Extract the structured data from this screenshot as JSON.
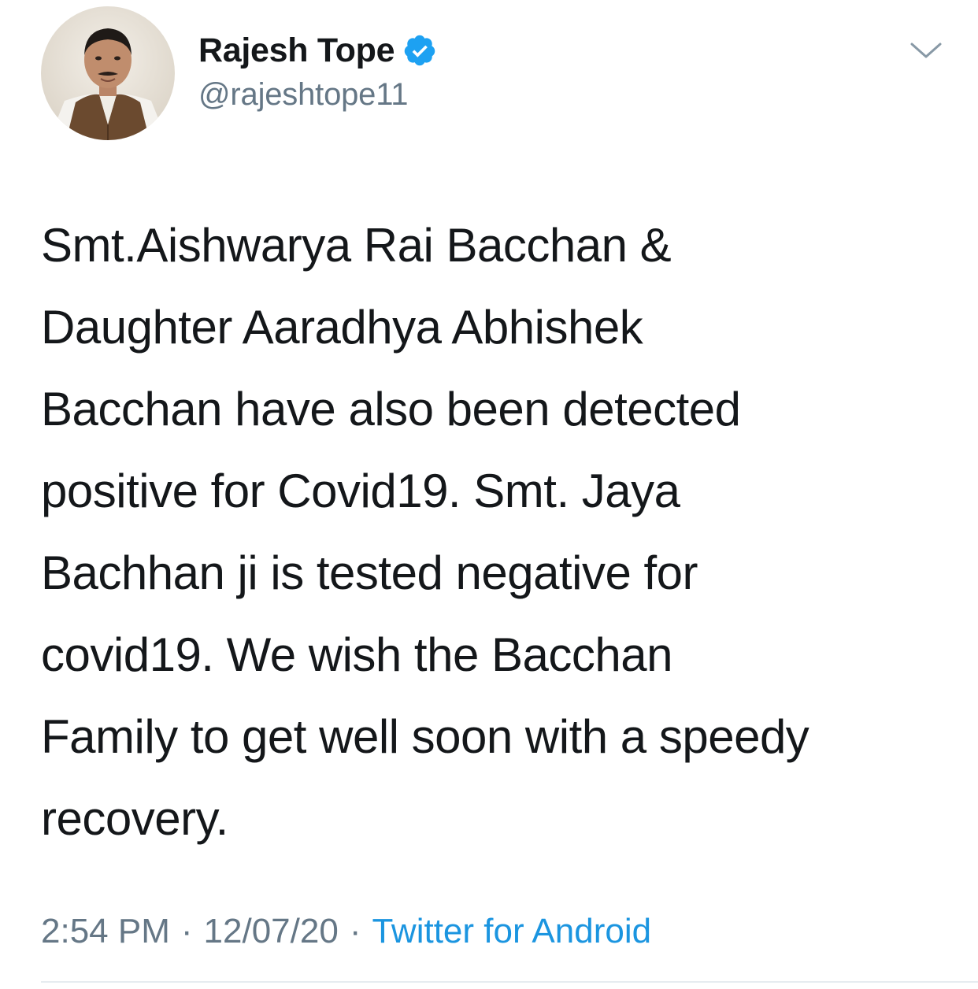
{
  "tweet": {
    "author": {
      "display_name": "Rajesh Tope",
      "handle": "@rajeshtope11",
      "verified": true,
      "avatar_icon": "profile-photo"
    },
    "text": "Smt.Aishwarya Rai Bacchan &\nDaughter Aaradhya Abhishek\nBacchan have also been detected\npositive for Covid19. Smt. Jaya\nBachhan ji is tested negative for\ncovid19. We wish the Bacchan\nFamily to get well soon with a speedy\nrecovery.",
    "meta": {
      "time": "2:54 PM",
      "separator": "·",
      "date": "12/07/20",
      "source": "Twitter for Android"
    },
    "menu_icon": "chevron-down-icon"
  },
  "colors": {
    "text_primary": "#14171a",
    "text_secondary": "#657786",
    "link": "#1b95e0",
    "verified_badge": "#1da1f2",
    "divider": "#e6ecf0"
  }
}
